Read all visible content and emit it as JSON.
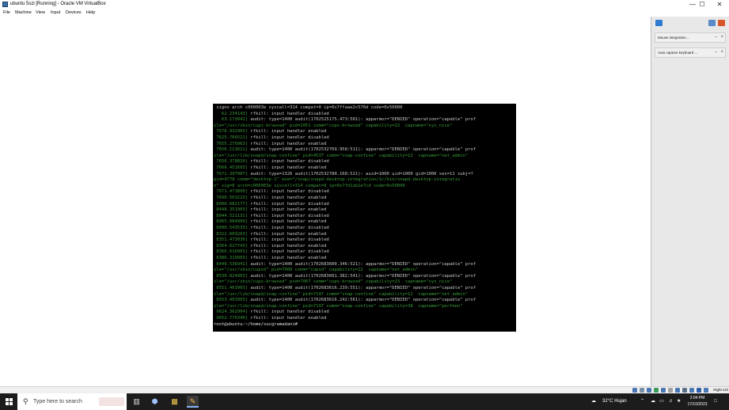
{
  "window": {
    "title": "ubuntu 5szi [Running] - Oracle VM VirtualBox",
    "controls": {
      "minimize": "—",
      "maximize": "☐",
      "close": "✕"
    }
  },
  "menu": [
    "File",
    "Machine",
    "View",
    "Input",
    "Devices",
    "Help"
  ],
  "terminal": {
    "lines": [
      [
        " ",
        "signo arch c000003e syscall=314 compat=0 ip=0x7ffaae2c576d code=0x50000"
      ],
      [
        "   62.234143] ",
        "rfkill: input handler disabled"
      ],
      [
        "   63.173041] ",
        "audit: type=1400 audit(1702525175.473:501): apparmor=\"DENIED\" operation=\"capable\" prof"
      ],
      [
        "ile=\"/usr/sbin/cups-browsed\" pid=2051 comm=\"cups-browsed\" capability=23  capname=\"sys_nice\"",
        ""
      ],
      [
        " 7676.932903] ",
        "rfkill: input handler enabled"
      ],
      [
        " 7625.766521] ",
        "rfkill: input handler disabled"
      ],
      [
        " 7655.275063] ",
        "rfkill: input handler enabled"
      ],
      [
        " 7656.113621] ",
        "audit: type=1400 audit(1702532769.958:511): apparmor=\"DENIED\" operation=\"capable\" prof"
      ],
      [
        "ile=\"/usr/lib/snapd/snap-confine\" pid=4537 comm=\"snap-confine\" capability=12  capname=\"net_admin\"",
        ""
      ],
      [
        " 7656.378820] ",
        "rfkill: input handler disabled"
      ],
      [
        " 7668.451693] ",
        "rfkill: input handler enabled"
      ],
      [
        " 7671.397907] ",
        "audit: type=1326 audit(1702532780.168:521): auid=1000 uid=1000 gid=1000 ses=11 subj=?"
      ],
      [
        "pid=4778 comm=\"desktop-1\" exe=\"/snap/snapd-desktop-integration/1c/bin/snapd-desktop-integratio",
        ""
      ],
      [
        "n\" sig=0 arch=c000003e syscall=314 compat=0 ip=0x7fd1ab1e7cd code=0x50000",
        ""
      ],
      [
        " 7671.473800] ",
        "rfkill: input handler disabled"
      ],
      [
        " 7690.563223] ",
        "rfkill: input handler enabled"
      ],
      [
        " 8000.682177] ",
        "rfkill: input handler disabled"
      ],
      [
        " 8448.351903] ",
        "rfkill: input handler enabled"
      ],
      [
        " 8044.521131] ",
        "rfkill: input handler disabled"
      ],
      [
        " 8065.684900] ",
        "rfkill: input handler enabled"
      ],
      [
        " 8090.543533] ",
        "rfkill: input handler disabled"
      ],
      [
        " 8322.603203] ",
        "rfkill: input handler enabled"
      ],
      [
        " 8351.473030] ",
        "rfkill: input handler disabled"
      ],
      [
        " 8364.627743] ",
        "rfkill: input handler enabled"
      ],
      [
        " 8366.616903] ",
        "rfkill: input handler disabled"
      ],
      [
        " 8386.310903] ",
        "rfkill: input handler enabled"
      ],
      [
        " 8449.536941] ",
        "audit: type=1400 audit(1702683600.346:521): apparmor=\"DENIED\" operation=\"capable\" prof"
      ],
      [
        "ile=\"/usr/sbin/cupsd\" pid=7066 comm=\"cupsd\" capability=12  capname=\"net_admin\"",
        ""
      ],
      [
        " 8530.824903] ",
        "audit: type=1400 audit(1702683601.382:541): apparmor=\"DENIED\" operation=\"capable\" prof"
      ],
      [
        "ile=\"/usr/sbin/cups-browsed\" pid=7067 comm=\"cups-browsed\" capability=23  capname=\"sys_nice\"",
        ""
      ],
      [
        " 8551.403903] ",
        "audit: type=1400 audit(1702683616.239:551): apparmor=\"DENIED\" operation=\"capable\" prof"
      ],
      [
        "ile=\"/usr/lib/snapd/snap-confine\" pid=7197 comm=\"snap-confine\" capability=12  capname=\"net_admin\"",
        ""
      ],
      [
        " 8553.403903] ",
        "audit: type=1400 audit(1702683616.242:561): apparmor=\"DENIED\" operation=\"capable\" prof"
      ],
      [
        "ile=\"/usr/lib/snapd/snap-confine\" pid=7197 comm=\"snap-confine\" capability=38  capname=\"perfmon\"",
        ""
      ],
      [
        " 9624.362904] ",
        "rfkill: input handler disabled"
      ],
      [
        " 9652.776340] ",
        "rfkill: input handler enabled"
      ],
      [
        "root@ubuntu:~/home/sucgramadani# ",
        ""
      ]
    ]
  },
  "panel": {
    "notifications": [
      {
        "text": "Mouse integration ...",
        "close": "×",
        "dismiss": "–"
      },
      {
        "text": "Auto capture keyboard ...",
        "close": "×",
        "dismiss": "–"
      }
    ]
  },
  "statusbar": {
    "host_key": "Right Ctrl"
  },
  "taskbar": {
    "search_placeholder": "Type here to search",
    "weather": "32°C  Hujan",
    "time": "2:04 PM",
    "date": "17/10/2023"
  }
}
